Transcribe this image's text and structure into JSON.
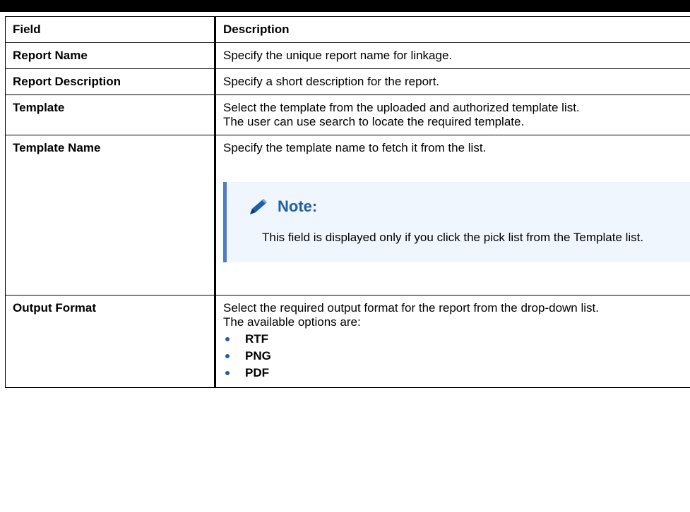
{
  "table": {
    "headers": [
      "Field",
      "Description"
    ],
    "rows": [
      {
        "field": "Report Name",
        "description": [
          "Specify the unique report name for linkage."
        ]
      },
      {
        "field": "Report Description",
        "description": [
          "Specify a short description for the report."
        ]
      },
      {
        "field": "Template",
        "description": [
          "Select the template from the uploaded and authorized template list.",
          "The user can use search to locate the required template."
        ]
      },
      {
        "field": "Template Name",
        "description": [
          "Specify the template name to fetch it from the list."
        ],
        "note": {
          "title": "Note:",
          "icon": "pencil-icon",
          "text": "This field is displayed only if you click the pick list from the Template list."
        }
      },
      {
        "field": "Output Format",
        "description": [
          "Select the required output format for the report from the drop-down list.",
          "The available options are:"
        ],
        "options": [
          "RTF",
          "PNG",
          "PDF"
        ]
      }
    ]
  },
  "colors": {
    "note_accent": "#4f7cc3",
    "note_title": "#1f5ea8",
    "note_background": "#f0f6fd",
    "bullet": "#1f5ea8"
  }
}
